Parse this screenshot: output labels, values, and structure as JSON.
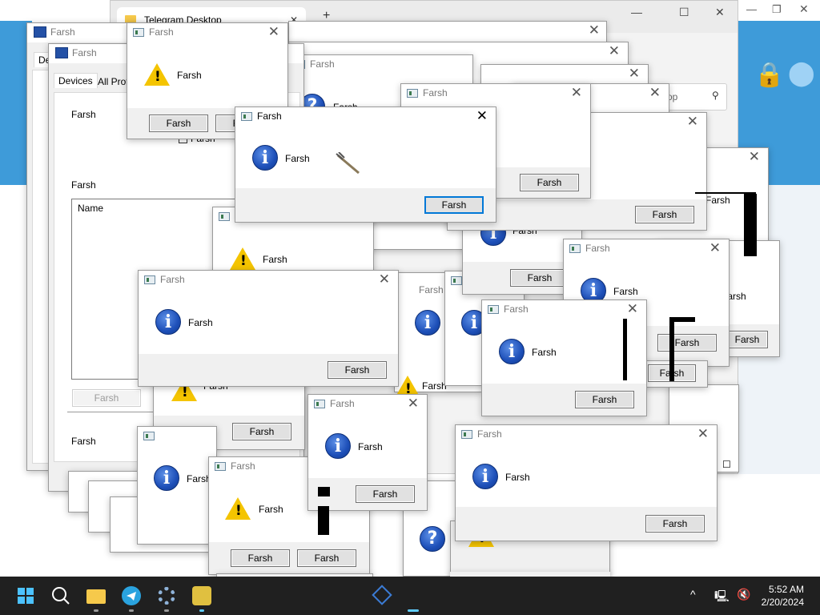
{
  "telegram": {
    "tab_title": "Telegram Desktop",
    "close_glyph": "✕",
    "new_tab_glyph": "+",
    "minimize_glyph": "—",
    "maximize_glyph": "☐",
    "search_placeholder": "op"
  },
  "app_title": "Farsh",
  "message": "Farsh",
  "button_label": "Farsh",
  "close_glyph": "✕",
  "settings": {
    "tab_devices": "Devices",
    "tab_all_profiles": "All Profi",
    "tab_short": "De",
    "label_1": "Farsh",
    "label_2": "Farsh",
    "label_3": "Farsh",
    "checkbox_label": "Farsh",
    "list_header": "Name",
    "disabled_button": "Farsh"
  },
  "icons": {
    "info_glyph": "i",
    "question_glyph": "?",
    "warning_glyph": "!"
  },
  "taskbar": {
    "time": "5:52 AM",
    "date": "2/20/2024",
    "chevron": "^"
  },
  "colors": {
    "telegram_blue": "#3e9bd9",
    "accent": "#0078d7",
    "taskbar": "#202020"
  }
}
